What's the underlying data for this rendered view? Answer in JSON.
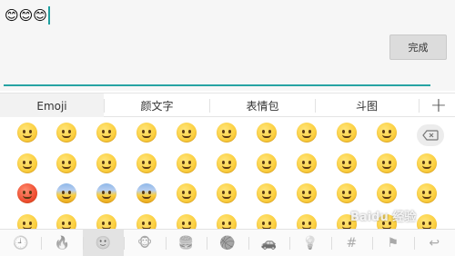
{
  "input": {
    "typed_text": "😊😊😊",
    "done_label": "完成"
  },
  "tabs": [
    {
      "label": "Emoji",
      "active": true
    },
    {
      "label": "颜文字",
      "active": false
    },
    {
      "label": "表情包",
      "active": false
    },
    {
      "label": "斗图",
      "active": false
    }
  ],
  "add_tab_label": "+",
  "backspace_icon": "backspace-icon",
  "emoji_rows": [
    [
      "😊",
      "😀",
      "😄",
      "😂",
      "😭",
      "☺️",
      "😍",
      "😘",
      "😚",
      "😜"
    ],
    [
      "😝",
      "😌",
      "😒",
      "😔",
      "😏",
      "😉",
      "😁",
      "😳",
      "🙄",
      "😷",
      "😣"
    ],
    [
      "😡",
      "😨",
      "😰",
      "😱",
      "😖",
      "😫",
      "😥",
      "😢",
      "😪",
      "😓",
      "😞"
    ],
    [
      "😬",
      "😵",
      "😤",
      "😇",
      "😖",
      "😣",
      "😩",
      "😫",
      "😦",
      "😐",
      "😈"
    ]
  ],
  "categories": [
    {
      "icon": "🕘",
      "name": "recent-icon"
    },
    {
      "icon": "🔥",
      "name": "fire-icon"
    },
    {
      "icon": "🙂",
      "name": "smiley-icon"
    },
    {
      "icon": "🐵",
      "name": "animal-icon"
    },
    {
      "icon": "🍔",
      "name": "food-icon"
    },
    {
      "icon": "🏀",
      "name": "sports-icon"
    },
    {
      "icon": "🚗",
      "name": "car-icon"
    },
    {
      "icon": "💡",
      "name": "bulb-icon"
    },
    {
      "icon": "#",
      "name": "hash-icon"
    },
    {
      "icon": "⚑",
      "name": "flag-icon"
    },
    {
      "icon": "↩",
      "name": "return-icon"
    }
  ],
  "watermark": "Baidu 经验",
  "colors": {
    "accent": "#26a3a3",
    "tab_active_bg": "#f2f2f2"
  }
}
